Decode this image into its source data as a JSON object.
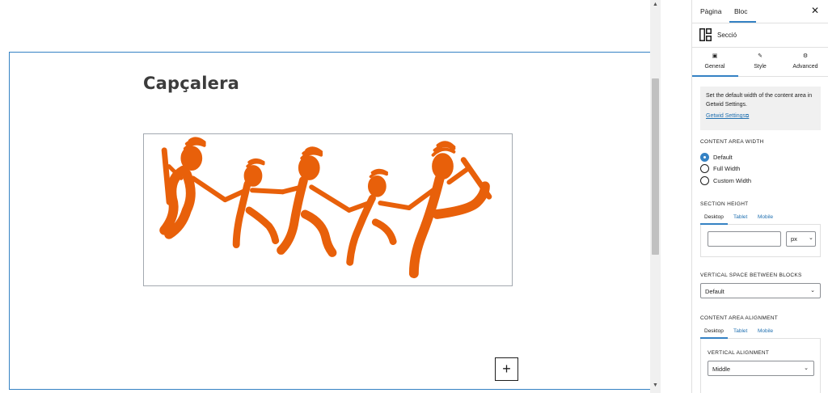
{
  "canvas": {
    "heading": "Capçalera",
    "inserter_label": "+",
    "scroll_up": "▲",
    "scroll_down": "▼"
  },
  "sidebar": {
    "tabs": {
      "page": "Pàgina",
      "block": "Bloc",
      "close": "✕"
    },
    "block_name": "Secció",
    "panel_tabs": [
      {
        "icon": "▣",
        "label": "General"
      },
      {
        "icon": "✎",
        "label": "Style"
      },
      {
        "icon": "⚙",
        "label": "Advanced"
      }
    ],
    "notice": {
      "text": "Set the default width of the content area in Getwid Settings.",
      "link": "Getwid Settings",
      "link_icon": "⧉"
    },
    "content_area_width": {
      "title": "CONTENT AREA WIDTH",
      "options": [
        "Default",
        "Full Width",
        "Custom Width"
      ],
      "selected": "Default"
    },
    "section_height": {
      "title": "SECTION HEIGHT",
      "devices": [
        "Desktop",
        "Tablet",
        "Mobile"
      ],
      "active_device": "Desktop",
      "value": "",
      "unit": "px"
    },
    "vertical_space": {
      "title": "VERTICAL SPACE BETWEEN BLOCKS",
      "value": "Default"
    },
    "content_area_alignment": {
      "title": "CONTENT AREA ALIGNMENT",
      "devices": [
        "Desktop",
        "Tablet",
        "Mobile"
      ],
      "active_device": "Desktop",
      "vertical_alignment_title": "VERTICAL ALIGNMENT",
      "vertical_alignment_value": "Middle"
    },
    "chevron": "⌄"
  },
  "colors": {
    "accent": "#3582c4",
    "figures": "#e8600a",
    "link": "#2271b1"
  }
}
